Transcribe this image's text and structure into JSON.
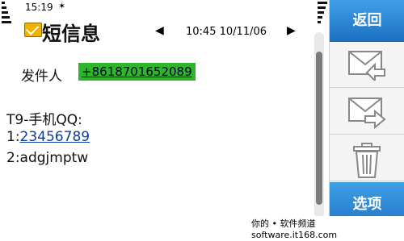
{
  "status": {
    "time": "15:19",
    "bluetooth": "✶"
  },
  "header": {
    "title": "短信息",
    "date": "10:45 10/11/06"
  },
  "message": {
    "sender_label": "发件人",
    "sender_number": "+8618701652089",
    "line1": "T9-手机QQ:",
    "line2_prefix": "1:",
    "line2_link": "23456789",
    "line3": "2:adgjmptw"
  },
  "panel": {
    "back_label": "返回",
    "options_label": "选项"
  },
  "watermark": "你的 • 软件频道  software.it168.com"
}
